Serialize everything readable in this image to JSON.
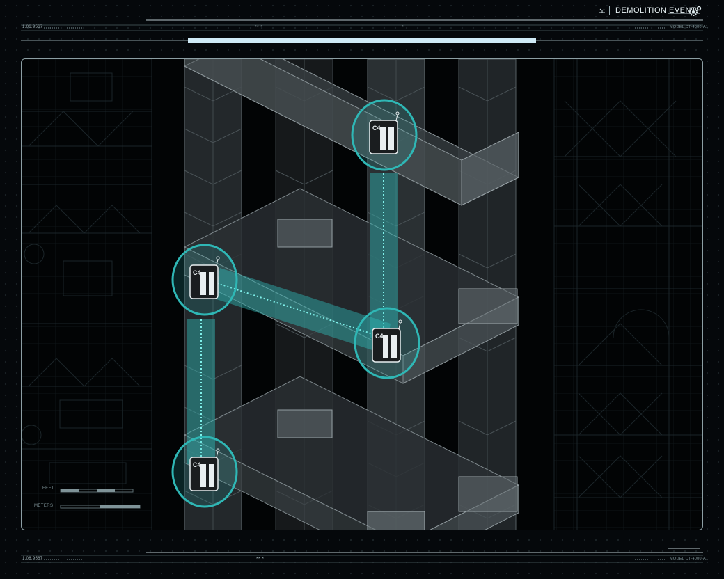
{
  "header": {
    "title": "DEMOLITION EVENT",
    "code_left": "1.06.9567",
    "code_right": "MODEL CT-4000-A1",
    "mark_center": "** *",
    "mark_small": "*"
  },
  "footer": {
    "code_left": "1.06.9567",
    "code_right": "MODEL CT-4000-A1",
    "mark_center": "** *"
  },
  "progress": {
    "fraction": 0.5
  },
  "scale": {
    "feet_label": "FEET",
    "meters_label": "METERS"
  },
  "charges": [
    {
      "label": "C4"
    },
    {
      "label": "C4"
    },
    {
      "label": "C4"
    },
    {
      "label": "C4"
    }
  ],
  "colors": {
    "accent": "#2fb7b5",
    "link": "#46d9d3",
    "progress": "#cfeaf6",
    "panel_border": "#8c9ea3"
  },
  "icons": {
    "title_icon": "detonator-icon",
    "settings_icon": "gear-icon",
    "charge_icon": "c4-charge-icon"
  }
}
